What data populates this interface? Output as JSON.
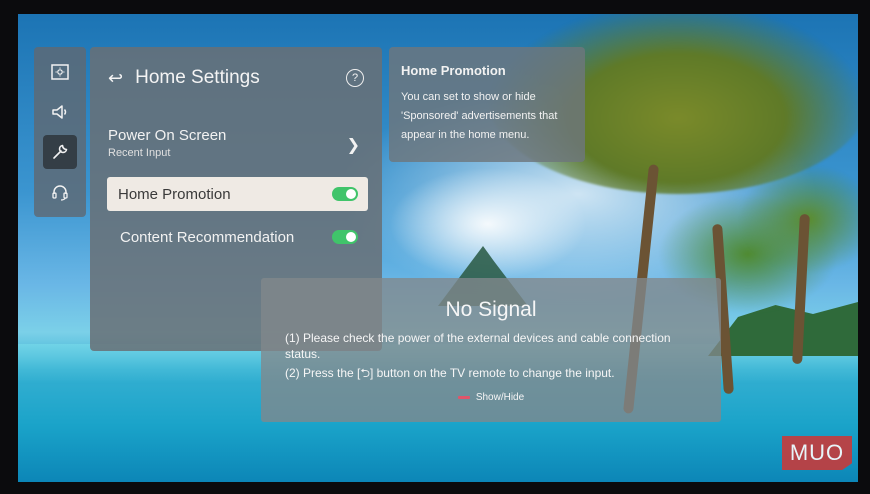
{
  "icons": {
    "picture": "picture-icon",
    "sound": "speaker-icon",
    "general": "wrench-icon",
    "support": "headset-icon",
    "back": "back-arrow-icon",
    "help": "question-mark-icon",
    "chevron": "chevron-right-icon"
  },
  "settings_panel": {
    "title": "Home Settings",
    "items": [
      {
        "label": "Power On Screen",
        "sublabel": "Recent Input"
      },
      {
        "label": "Home Promotion",
        "toggle": "on"
      },
      {
        "label": "Content Recommendation",
        "toggle": "on"
      }
    ]
  },
  "info_card": {
    "title": "Home Promotion",
    "body_lines": [
      "You can set to show or hide",
      "'Sponsored' advertisements that",
      "appear in the home menu."
    ]
  },
  "dialog": {
    "title": "No Signal",
    "line1": "(1) Please check the power of the external devices and cable connection",
    "line2": "status.",
    "line3": "(2) Press the [⮌] button on the TV remote to change the input.",
    "show_hide": "Show/Hide"
  },
  "watermark": "MUO",
  "colors": {
    "toggle_on": "#40c46a",
    "selected_row": "#efeae4",
    "red_key": "#e0556a",
    "watermark": "#c73b3b"
  }
}
